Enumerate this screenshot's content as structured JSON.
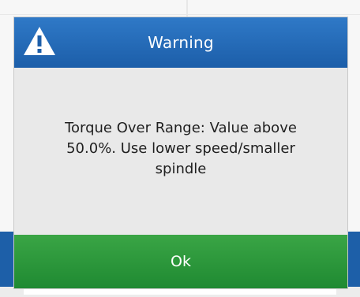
{
  "dialog": {
    "title": "Warning",
    "icon": "warning-triangle-icon",
    "message_lines": [
      "Torque Over Range: Value above",
      "50.0%. Use lower speed/smaller",
      "spindle"
    ],
    "ok_label": "Ok"
  },
  "colors": {
    "header_blue": "#1c5ea9",
    "button_green": "#1f8a32",
    "dialog_bg": "#e9e9e9",
    "background_blue_strip": "#1d5fa8"
  }
}
